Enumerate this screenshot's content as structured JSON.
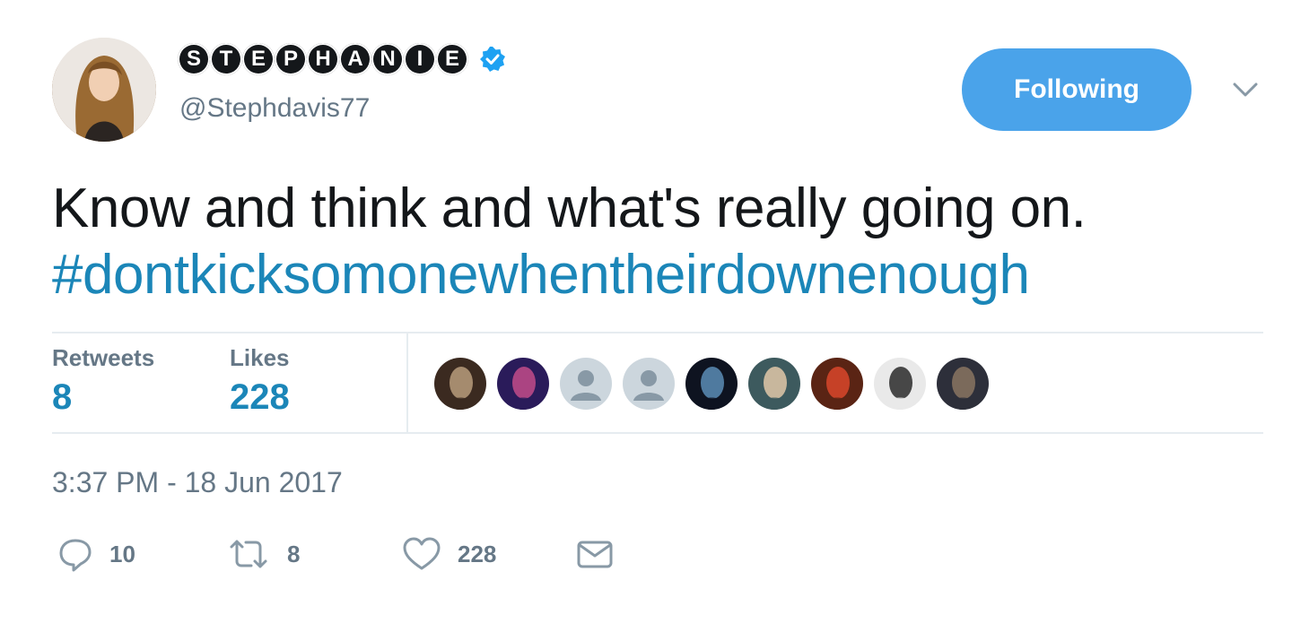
{
  "user": {
    "display_name_letters": [
      "S",
      "T",
      "E",
      "P",
      "H",
      "A",
      "N",
      "I",
      "E"
    ],
    "handle": "@Stephdavis77",
    "verified_color": "#1da1f2"
  },
  "follow_button": {
    "label": "Following",
    "color": "#4aa3ea"
  },
  "tweet": {
    "text": "Know and think and what's really going on.",
    "hashtag": "#dontkicksomonewhentheirdownenough"
  },
  "stats": {
    "retweets_label": "Retweets",
    "retweets_value": "8",
    "likes_label": "Likes",
    "likes_value": "228"
  },
  "likers": [
    {
      "style": "photo",
      "c1": "#3b2a20",
      "c2": "#b99c7c"
    },
    {
      "style": "photo",
      "c1": "#2a1b5a",
      "c2": "#c24b8a"
    },
    {
      "style": "default",
      "c1": "#ccd6dd",
      "c2": "#8899a6"
    },
    {
      "style": "default",
      "c1": "#ccd6dd",
      "c2": "#8899a6"
    },
    {
      "style": "photo",
      "c1": "#0e1320",
      "c2": "#5b8db6"
    },
    {
      "style": "photo",
      "c1": "#3d5a5e",
      "c2": "#e0c8a8"
    },
    {
      "style": "photo",
      "c1": "#5a2414",
      "c2": "#d9472a"
    },
    {
      "style": "photo",
      "c1": "#e9e9e9",
      "c2": "#2a2a2a"
    },
    {
      "style": "photo",
      "c1": "#2d2f3a",
      "c2": "#8a7462"
    }
  ],
  "timestamp": "3:37 PM - 18 Jun 2017",
  "actions": {
    "reply_count": "10",
    "retweet_count": "8",
    "like_count": "228"
  },
  "icons": {
    "reply": "reply-icon",
    "retweet": "retweet-icon",
    "like": "heart-icon",
    "dm": "envelope-icon",
    "caret": "chevron-down-icon",
    "verified": "verified-badge-icon"
  }
}
